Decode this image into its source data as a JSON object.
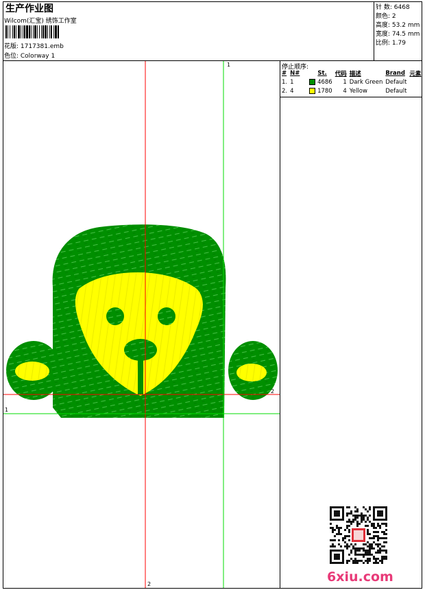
{
  "header": {
    "title": "生产作业图",
    "subtitle": "Wilcom(汇宝) 绣饰工作室",
    "design_label": "花版: 1717381.emb",
    "colorway_label": "色位: Colorway 1"
  },
  "stats": [
    {
      "label": "针 数:",
      "value": "6468"
    },
    {
      "label": "颜色:",
      "value": "2"
    },
    {
      "label": "高度:",
      "value": "53.2 mm"
    },
    {
      "label": "宽度:",
      "value": "74.5 mm"
    },
    {
      "label": "比例:",
      "value": "1.79"
    }
  ],
  "stop_sequence": {
    "title": "停止顺序:",
    "headers": [
      "#",
      "N#",
      "St.",
      "代码",
      "描述",
      "Brand",
      "元素"
    ],
    "rows": [
      {
        "idx": "1.",
        "needle": "1",
        "code": "4686",
        "stop": "1",
        "desc": "Dark Green",
        "brand": "Default",
        "color": "#009100"
      },
      {
        "idx": "2.",
        "needle": "4",
        "code": "1780",
        "stop": "4",
        "desc": "Yellow",
        "brand": "Default",
        "color": "#ffff00"
      }
    ]
  },
  "axes": {
    "green_label": "1",
    "red_label": "2"
  },
  "colors": {
    "green": "#008f00",
    "yellow": "#ffff00",
    "guide_red": "#ff0000",
    "guide_green": "#00dd00"
  },
  "watermark": "6xiu.com"
}
